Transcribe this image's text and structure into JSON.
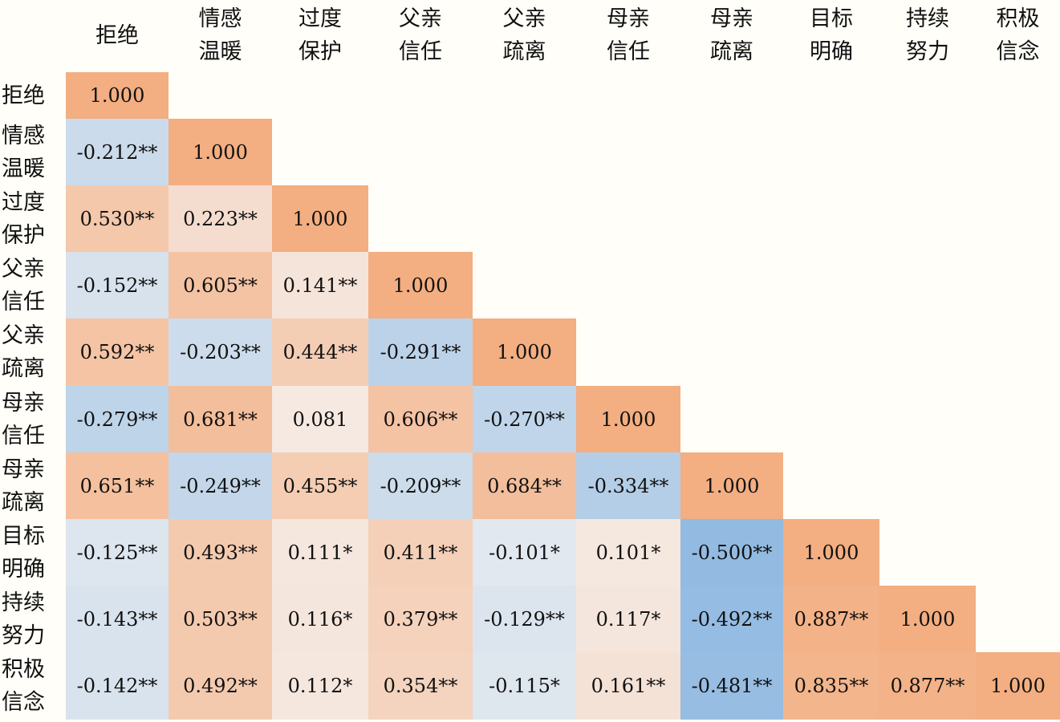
{
  "chart_data": {
    "type": "heatmap",
    "variables": [
      "拒绝",
      "情感\n温暖",
      "过度\n保护",
      "父亲\n信任",
      "父亲\n疏离",
      "母亲\n信任",
      "母亲\n疏离",
      "目标\n明确",
      "持续\n努力",
      "积极\n信念"
    ],
    "values": [
      [
        1.0
      ],
      [
        -0.212,
        1.0
      ],
      [
        0.53,
        0.223,
        1.0
      ],
      [
        -0.152,
        0.605,
        0.141,
        1.0
      ],
      [
        0.592,
        -0.203,
        0.444,
        -0.291,
        1.0
      ],
      [
        -0.279,
        0.681,
        0.081,
        0.606,
        -0.27,
        1.0
      ],
      [
        0.651,
        -0.249,
        0.455,
        -0.209,
        0.684,
        -0.334,
        1.0
      ],
      [
        -0.125,
        0.493,
        0.111,
        0.411,
        -0.101,
        0.101,
        -0.5,
        1.0
      ],
      [
        -0.143,
        0.503,
        0.116,
        0.379,
        -0.129,
        0.117,
        -0.492,
        0.887,
        1.0
      ],
      [
        -0.142,
        0.492,
        0.112,
        0.354,
        -0.115,
        0.161,
        -0.481,
        0.835,
        0.877,
        1.0
      ]
    ],
    "labels": [
      [
        "1.000"
      ],
      [
        "-0.212**",
        "1.000"
      ],
      [
        "0.530**",
        "0.223**",
        "1.000"
      ],
      [
        "-0.152**",
        "0.605**",
        "0.141**",
        "1.000"
      ],
      [
        "0.592**",
        "-0.203**",
        "0.444**",
        "-0.291**",
        "1.000"
      ],
      [
        "-0.279**",
        "0.681**",
        "0.081",
        "0.606**",
        "-0.270**",
        "1.000"
      ],
      [
        "0.651**",
        "-0.249**",
        "0.455**",
        "-0.209**",
        "0.684**",
        "-0.334**",
        "1.000"
      ],
      [
        "-0.125**",
        "0.493**",
        "0.111*",
        "0.411**",
        "-0.101*",
        "0.101*",
        "-0.500**",
        "1.000"
      ],
      [
        "-0.143**",
        "0.503**",
        "0.116*",
        "0.379**",
        "-0.129**",
        "0.117*",
        "-0.492**",
        "0.887**",
        "1.000"
      ],
      [
        "-0.142**",
        "0.492**",
        "0.112*",
        "0.354**",
        "-0.115*",
        "0.161**",
        "-0.481**",
        "0.835**",
        "0.877**",
        "1.000"
      ]
    ],
    "colors": {
      "positive": "#f3ae81",
      "negative": "#93bbe2",
      "neutral": "#f5f3f2"
    }
  }
}
